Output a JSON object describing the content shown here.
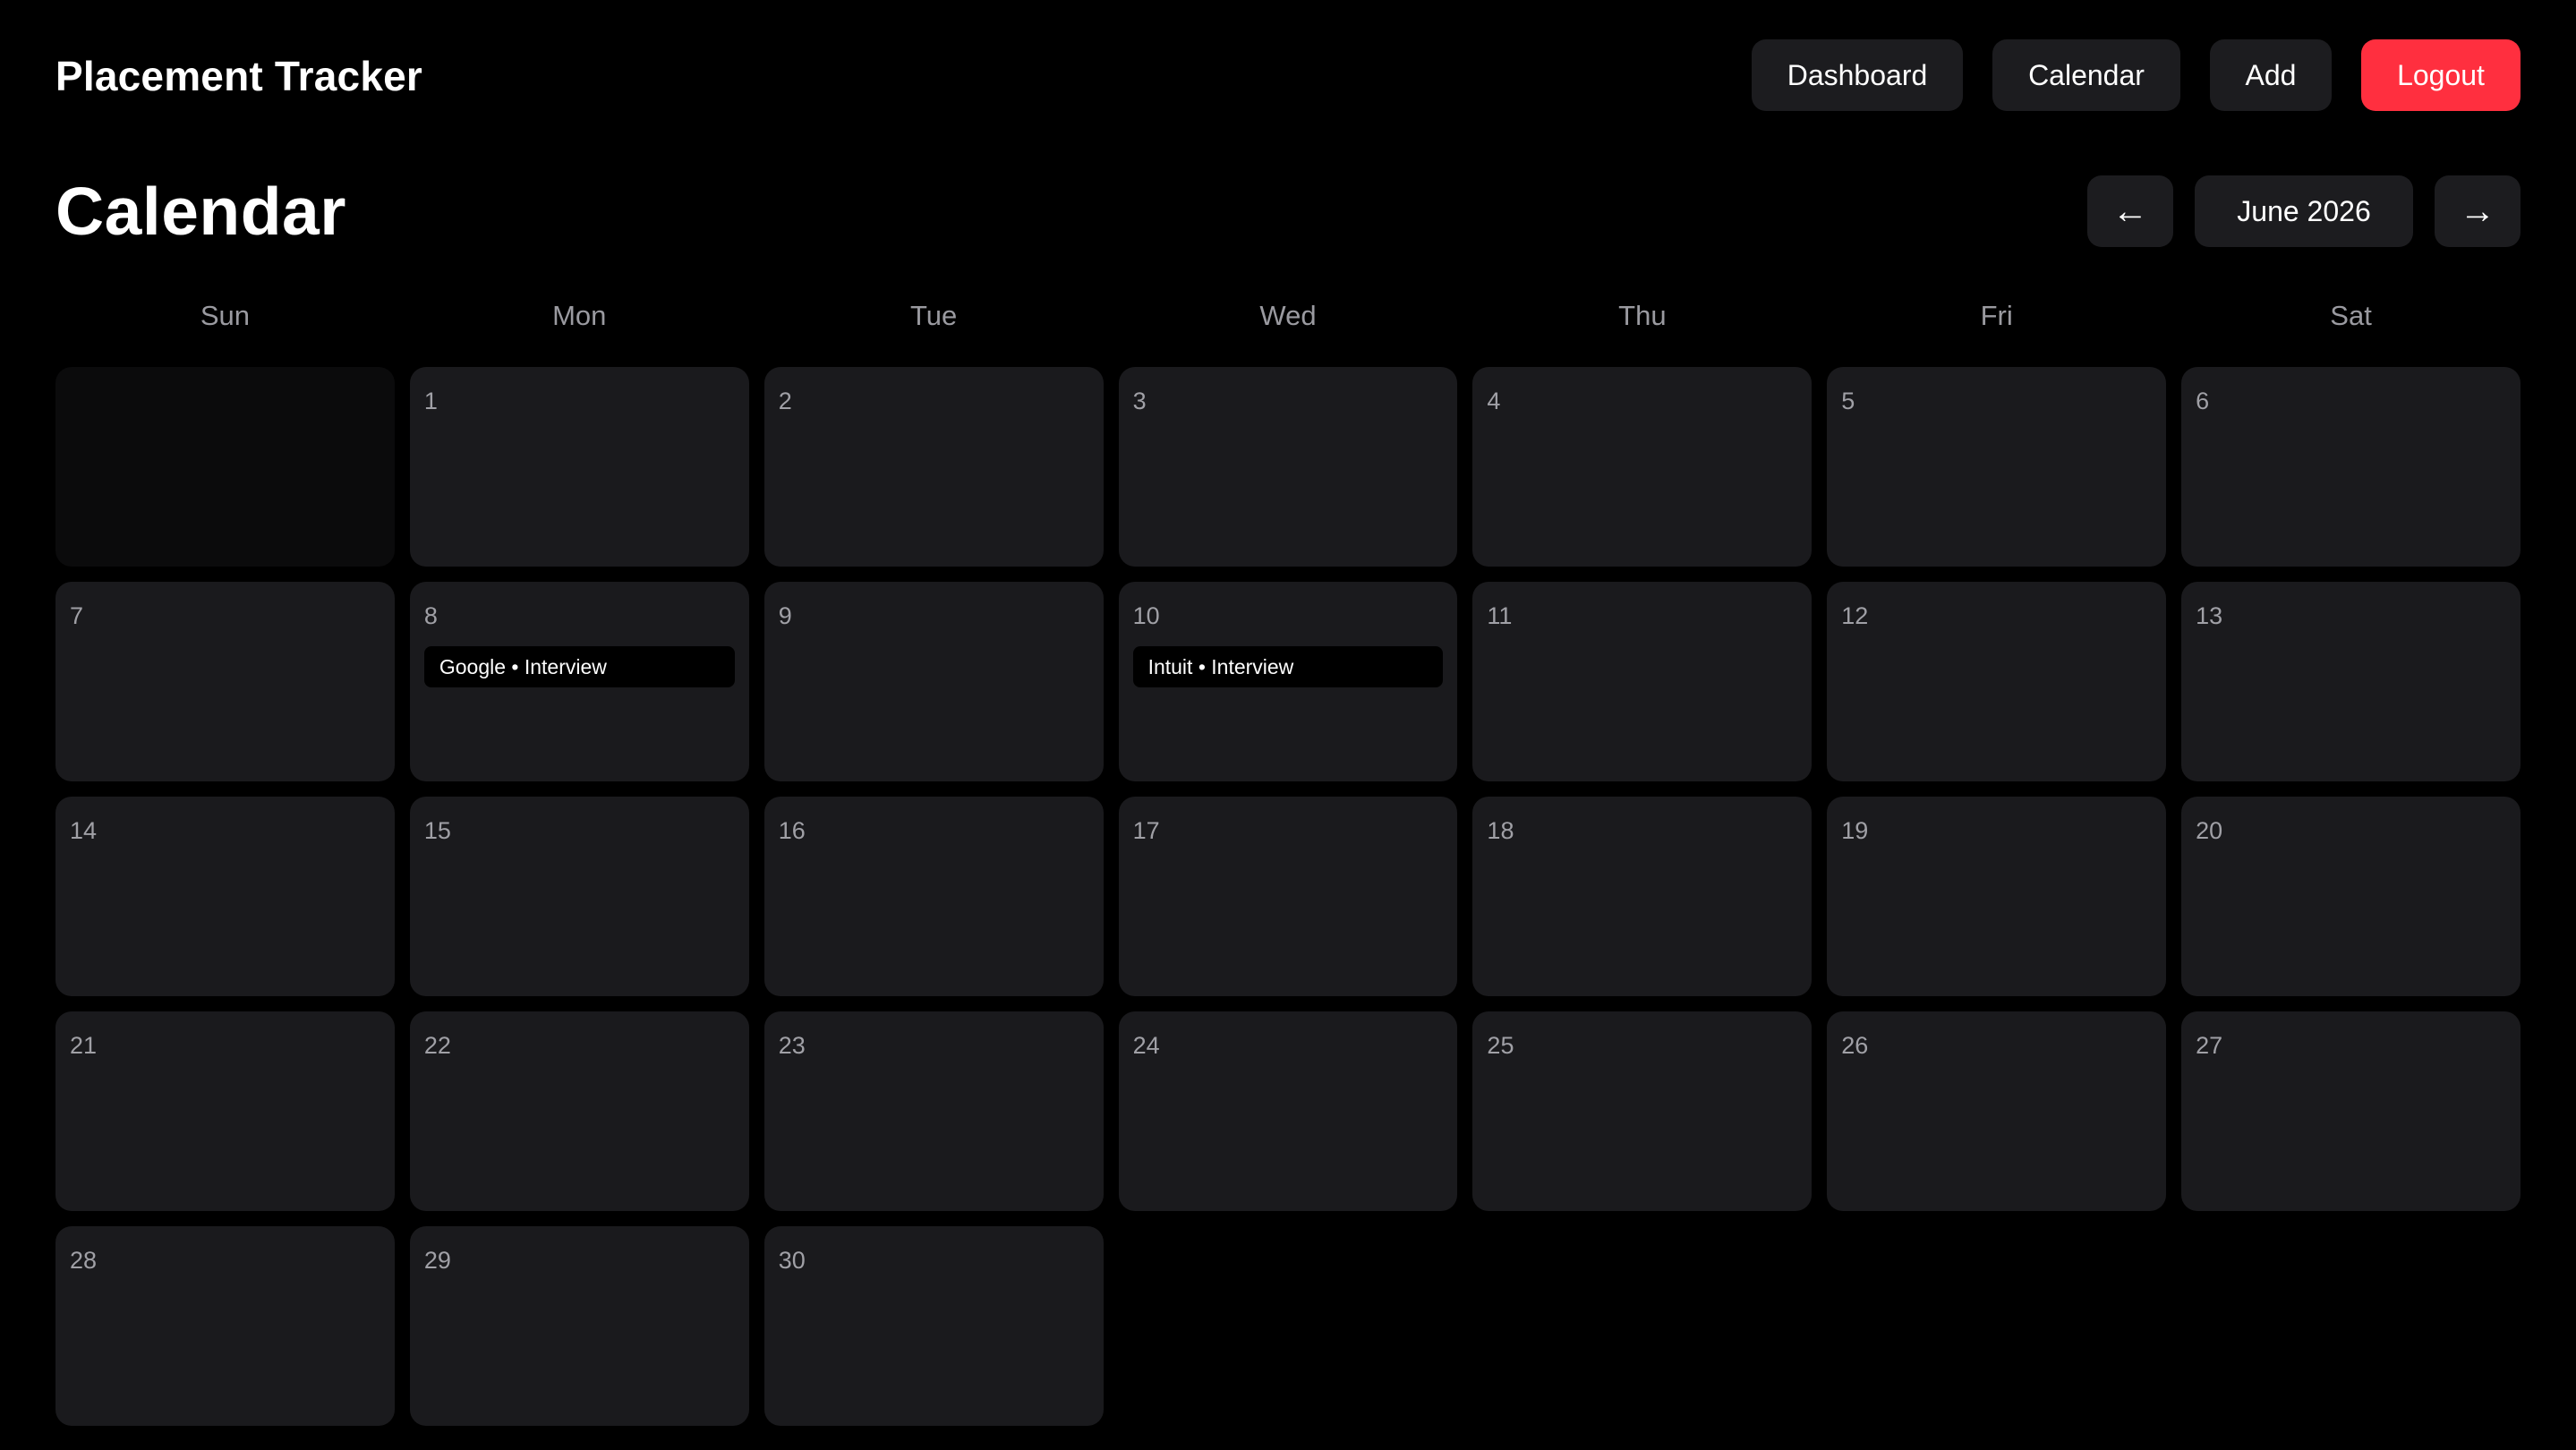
{
  "app": {
    "brand": "Placement Tracker"
  },
  "nav": {
    "dashboard": "Dashboard",
    "calendar": "Calendar",
    "add": "Add",
    "logout": "Logout",
    "logout_color": "#ff2f3f"
  },
  "page": {
    "title": "Calendar"
  },
  "month_nav": {
    "prev_icon": "←",
    "next_icon": "→",
    "label": "June 2026"
  },
  "weekdays": [
    "Sun",
    "Mon",
    "Tue",
    "Wed",
    "Thu",
    "Fri",
    "Sat"
  ],
  "calendar": {
    "leading_blank_days": 1,
    "days_in_month": 30,
    "events": [
      {
        "day": 8,
        "label": "Google • Interview"
      },
      {
        "day": 10,
        "label": "Intuit • Interview"
      }
    ]
  }
}
